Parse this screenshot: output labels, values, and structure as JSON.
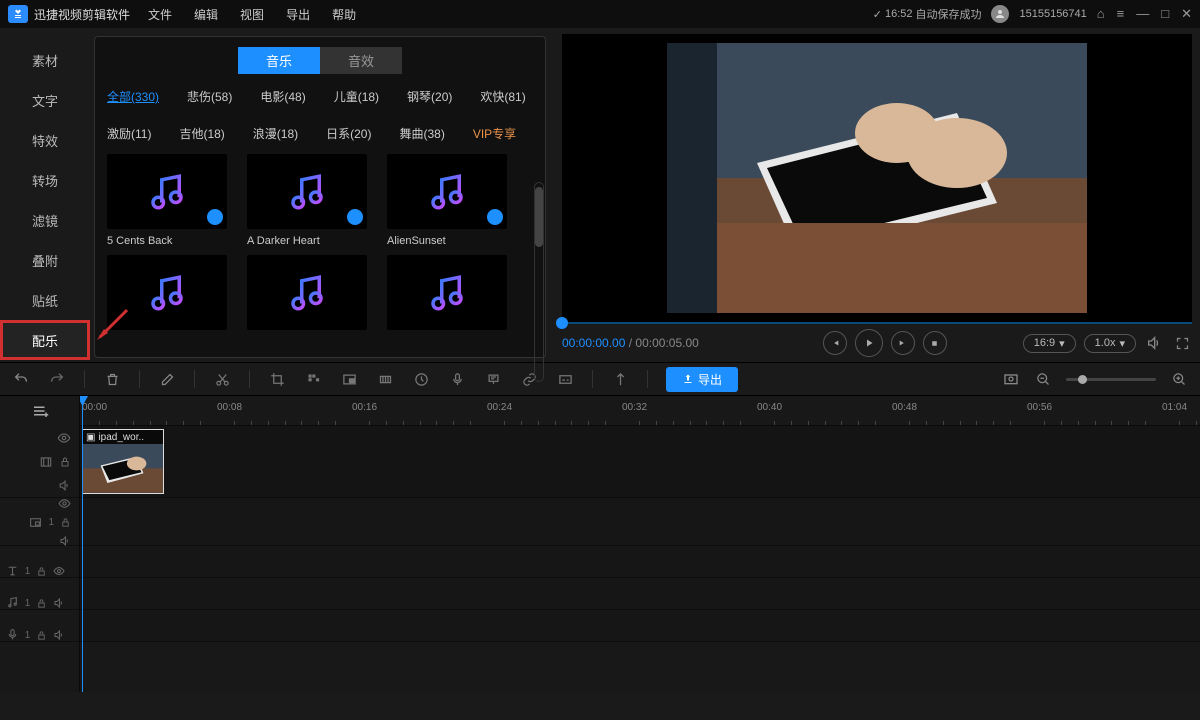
{
  "app": {
    "title": "迅捷视频剪辑软件"
  },
  "menu": [
    "文件",
    "编辑",
    "视图",
    "导出",
    "帮助"
  ],
  "status": {
    "time": "16:52",
    "text": "自动保存成功",
    "user": "15155156741"
  },
  "sidebar": {
    "items": [
      {
        "label": "素材"
      },
      {
        "label": "文字"
      },
      {
        "label": "特效"
      },
      {
        "label": "转场"
      },
      {
        "label": "滤镜"
      },
      {
        "label": "叠附"
      },
      {
        "label": "贴纸"
      },
      {
        "label": "配乐"
      }
    ]
  },
  "library": {
    "tabs": [
      "音乐",
      "音效"
    ],
    "categories": [
      {
        "label": "全部(330)",
        "active": true
      },
      {
        "label": "悲伤(58)"
      },
      {
        "label": "电影(48)"
      },
      {
        "label": "儿童(18)"
      },
      {
        "label": "钢琴(20)"
      },
      {
        "label": "欢快(81)"
      },
      {
        "label": "激励(11)"
      },
      {
        "label": "吉他(18)"
      },
      {
        "label": "浪漫(18)"
      },
      {
        "label": "日系(20)"
      },
      {
        "label": "舞曲(38)"
      },
      {
        "label": "VIP专享",
        "vip": true
      }
    ],
    "items": [
      {
        "name": "5 Cents Back"
      },
      {
        "name": "A Darker Heart"
      },
      {
        "name": "AlienSunset"
      },
      {
        "name": ""
      },
      {
        "name": ""
      },
      {
        "name": ""
      }
    ]
  },
  "preview": {
    "current": "00:00:00.00",
    "duration": "00:00:05.00",
    "aspect": "16:9",
    "speed": "1.0x"
  },
  "toolbar": {
    "export": "导出"
  },
  "ruler": [
    "00:00",
    "00:08",
    "00:16",
    "00:24",
    "00:32",
    "00:40",
    "00:48",
    "00:56",
    "01:04"
  ],
  "clip": {
    "name": "ipad_wor.."
  }
}
